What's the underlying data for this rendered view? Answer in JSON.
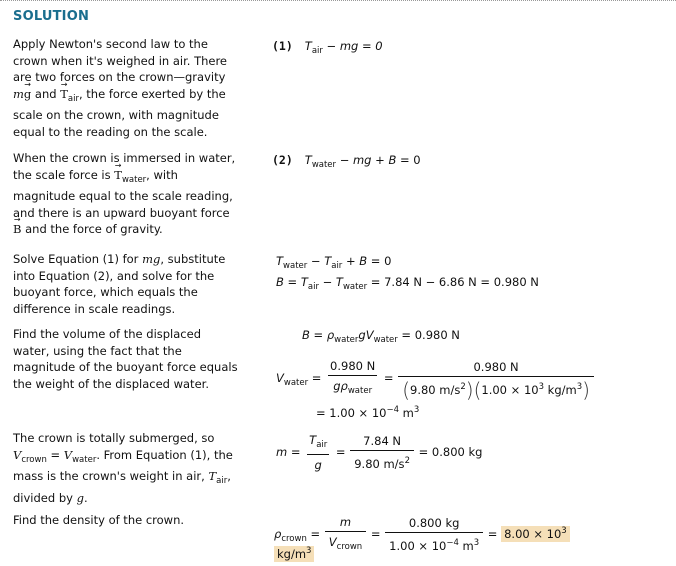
{
  "heading": "SOLUTION",
  "steps": [
    {
      "text_parts": [
        "Apply Newton's second law to the crown when it's weighed in air. There are two forces on the crown—gravity ",
        "m",
        "g",
        " and ",
        "T",
        "air",
        ", the force exerted by the scale on the crown, with magnitude equal to the reading on the scale."
      ],
      "equation": {
        "number": "(1)",
        "lhs_sym": "T",
        "lhs_sub": "air",
        "rest": "− mg = 0"
      }
    },
    {
      "text_parts": [
        "When the crown is immersed in water, the scale force is ",
        "T",
        "water",
        ", with magnitude equal to the scale reading, and there is an upward buoyant force ",
        "B",
        " and the force of gravity."
      ],
      "equation": {
        "number": "(2)",
        "lhs_sym": "T",
        "lhs_sub": "water",
        "rest1": "− ",
        "mg": "mg",
        "rest2": " + ",
        "B": "B",
        "rest3": " = 0"
      }
    },
    {
      "text_parts": [
        "Solve Equation (1) for ",
        "mg",
        ", substitute into Equation (2), and solve for the buoyant force, which equals the difference in scale readings."
      ],
      "eq_line1": {
        "t1": "T",
        "s1": "water",
        "op1": " − ",
        "t2": "T",
        "s2": "air",
        "op2": " + ",
        "b": "B",
        "end": " = 0"
      },
      "eq_line2": {
        "b": "B",
        "eq": " = ",
        "t1": "T",
        "s1": "air",
        "op": " − ",
        "t2": "T",
        "s2": "water",
        "end": " = 7.84 N − 6.86 N = 0.980 N"
      }
    },
    {
      "text": "Find the volume of the displaced water, using the fact that the magnitude of the buoyant force equals the weight of the displaced water.",
      "eq_line1": {
        "b": "B",
        "eq": " = ",
        "rho": "ρ",
        "rho_sub": "water",
        "g": "g",
        "v": "V",
        "v_sub": "water",
        "end": " = 0.980 N"
      },
      "eq_line2": {
        "v": "V",
        "v_sub": "water",
        "eq": " = ",
        "f1_num": "0.980 N",
        "f1_den_g": "g",
        "f1_den_rho": "ρ",
        "f1_den_sub": "water",
        "eq2": " = ",
        "f2_num": "0.980 N",
        "f2_den_a": "9.80 m/s",
        "f2_den_a_sup": "2",
        "f2_den_b": "1.00 × 10",
        "f2_den_b_sup": "3",
        "f2_den_b_unit": " kg/m",
        "f2_den_b_unit_sup": "3"
      },
      "eq_line3": {
        "eq": "= 1.00 × 10",
        "sup": "−4",
        "unit": " m",
        "unit_sup": "3"
      }
    },
    {
      "text_parts": [
        "The crown is totally submerged, so ",
        "V",
        "crown",
        " = ",
        "V",
        "water",
        ". From Equation (1), the mass is the crown's weight in air, ",
        "T",
        "air",
        ", divided by ",
        "g",
        "."
      ],
      "equation": {
        "m": "m",
        "eq": " = ",
        "f1_num_t": "T",
        "f1_num_sub": "air",
        "f1_den": "g",
        "eq2": " = ",
        "f2_num": "7.84 N",
        "f2_den": "9.80 m/s",
        "f2_den_sup": "2",
        "end": " = 0.800 kg"
      }
    },
    {
      "text": "Find the density of the crown.",
      "equation": {
        "rho": "ρ",
        "rho_sub": "crown",
        "eq": " = ",
        "f1_num": "m",
        "f1_den_v": "V",
        "f1_den_sub": "crown",
        "eq2": " = ",
        "f2_num": "0.800 kg",
        "f2_den": "1.00 × 10",
        "f2_den_sup": "−4",
        "f2_den_unit": " m",
        "f2_den_unit_sup": "3",
        "eq3": " = ",
        "answer_a": "8.00 × 10",
        "answer_a_sup": "3",
        "answer_b": "kg/m",
        "answer_b_sup": "3"
      }
    }
  ],
  "colors": {
    "heading": "#1a6e8e",
    "answer_highlight": "#f5dfb8"
  }
}
